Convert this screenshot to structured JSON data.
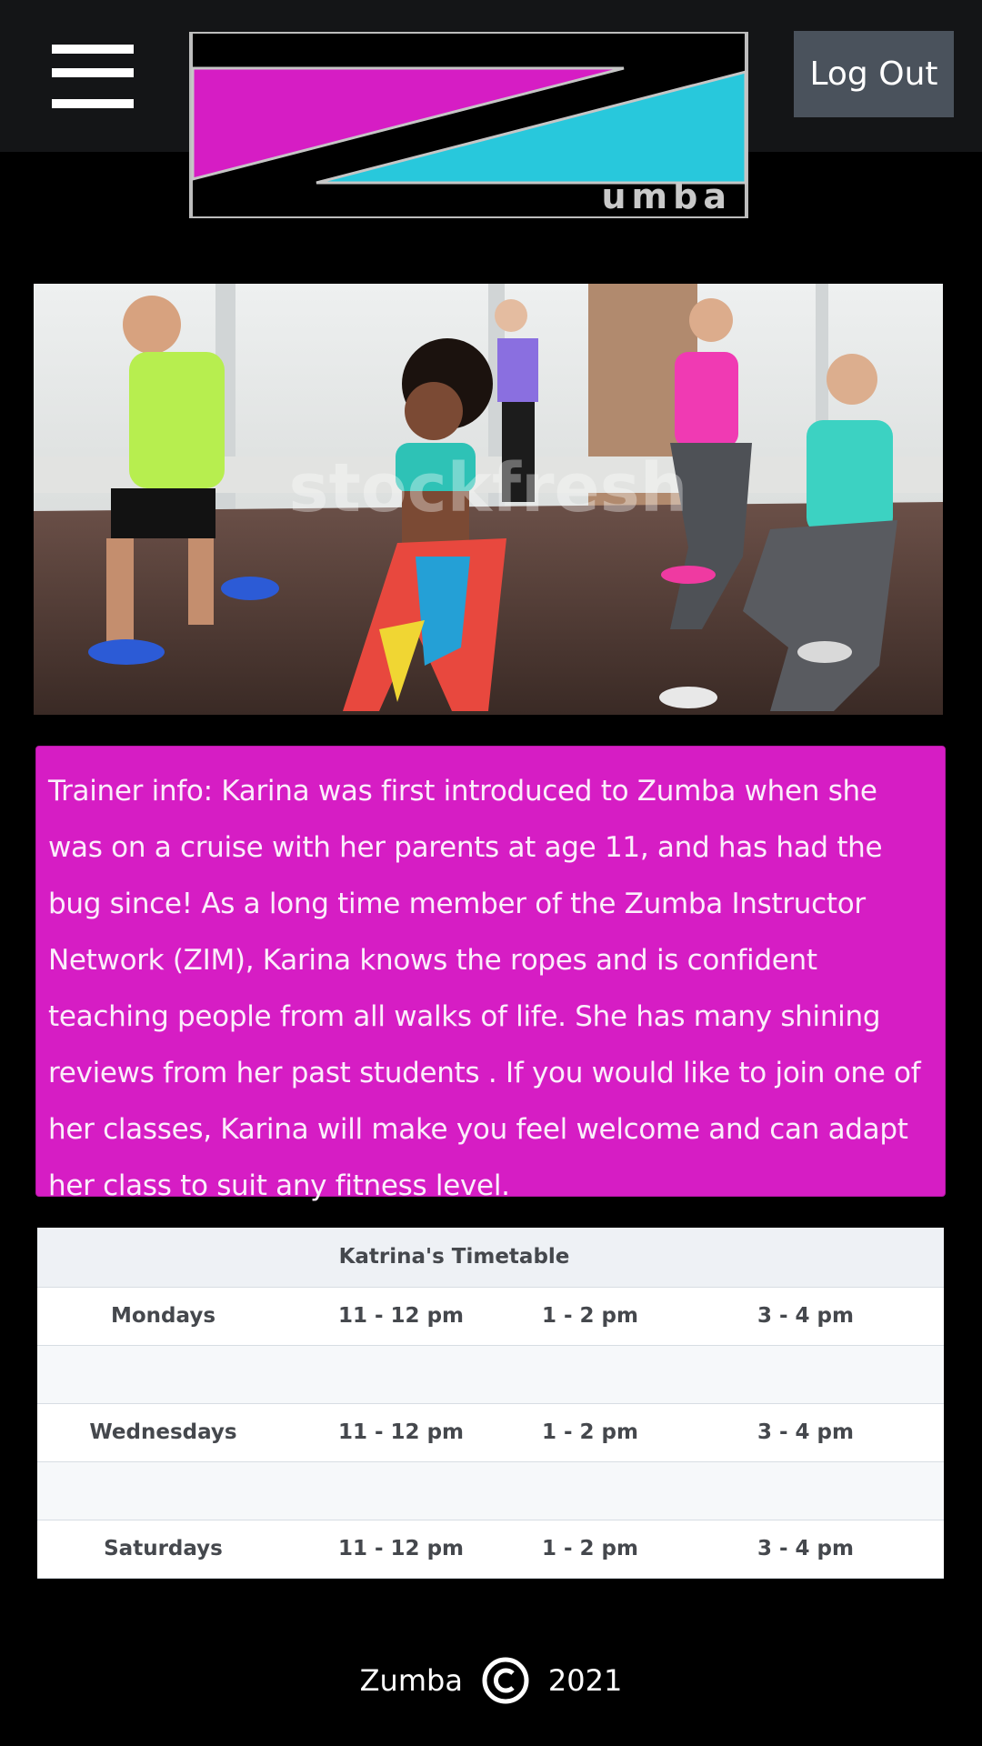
{
  "header": {
    "logo_text": "umba",
    "logout_label": "Log Out"
  },
  "hero": {
    "watermark": "stockfresh"
  },
  "trainer": {
    "text": "Trainer info: Karina was first introduced to Zumba when she was on a cruise with her parents at age 11, and has had the bug since! As a long time member of the Zumba Instructor Network (ZIM), Karina knows the ropes and is confident teaching people from all walks of life. She has many shining reviews from her past students . If you would like to join one of her classes, Karina will make you feel welcome and can adapt her class to suit any fitness level."
  },
  "timetable": {
    "title": "Katrina's Timetable",
    "rows": [
      {
        "day": "Mondays",
        "s1": "11 - 12 pm",
        "s2": "1 - 2 pm",
        "s3": "3 - 4 pm"
      },
      {
        "day": "",
        "s1": "",
        "s2": "",
        "s3": ""
      },
      {
        "day": "Wednesdays",
        "s1": "11 - 12 pm",
        "s2": "1 - 2 pm",
        "s3": "3 - 4 pm"
      },
      {
        "day": "",
        "s1": "",
        "s2": "",
        "s3": ""
      },
      {
        "day": "Saturdays",
        "s1": "11 - 12 pm",
        "s2": "1 - 2 pm",
        "s3": "3 - 4 pm"
      }
    ]
  },
  "footer": {
    "brand": "Zumba",
    "copyright_icon": "copyright-icon",
    "year": "2021"
  },
  "colors": {
    "navbar": "#141517",
    "magenta": "#d61dc4",
    "cyan": "#28c8dc",
    "logout_bg": "#4a525c",
    "table_text": "#45484d"
  }
}
